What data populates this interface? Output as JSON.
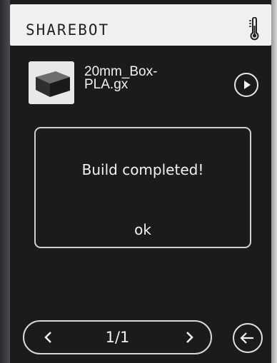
{
  "header": {
    "brand": "SHAREBOT",
    "temperature_icon": "thermometer-icon"
  },
  "file": {
    "name": "20mm_Box-\nPLA.gx",
    "thumbnail_icon": "printed-box-thumbnail",
    "play_icon": "play-icon"
  },
  "dialog": {
    "message": "Build completed!",
    "ok_label": "ok"
  },
  "pager": {
    "text": "1/1",
    "prev_icon": "chevron-left-icon",
    "next_icon": "chevron-right-icon"
  },
  "back_icon": "arrow-left-icon",
  "colors": {
    "screen_bg": "#1b1b1c",
    "header_bg": "#eff0f0",
    "foreground": "#f2f2f2"
  }
}
